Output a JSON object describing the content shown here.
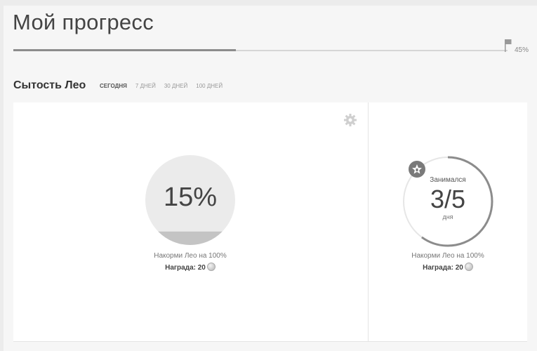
{
  "header": {
    "title": "Мой прогресс",
    "progress": 0.45,
    "progress_label": "45%"
  },
  "section": {
    "title": "Сытость Лео",
    "tabs": [
      {
        "label": "СЕГОДНЯ",
        "active": true
      },
      {
        "label": "7 ДНЕЙ",
        "active": false
      },
      {
        "label": "30 ДНЕЙ",
        "active": false
      },
      {
        "label": "100 ДНЕЙ",
        "active": false
      }
    ]
  },
  "left_panel": {
    "percent_label": "15%",
    "fill_fraction": 0.15,
    "goal": "Накорми Лео на 100%",
    "reward": "Награда: 20"
  },
  "right_panel": {
    "caption_top": "Занимался",
    "value": "3/5",
    "caption_bottom": "дня",
    "progress": 0.6,
    "goal": "Накорми Лео на 100%",
    "reward": "Награда: 20"
  },
  "icons": {
    "settings": "gear-icon",
    "goal": "flag-icon",
    "badge": "star-badge-icon",
    "reward": "coin-icon"
  },
  "colors": {
    "accent": "#8c8c8c",
    "circle_bg": "#ebebeb",
    "circle_fill": "#c4c4c4"
  }
}
